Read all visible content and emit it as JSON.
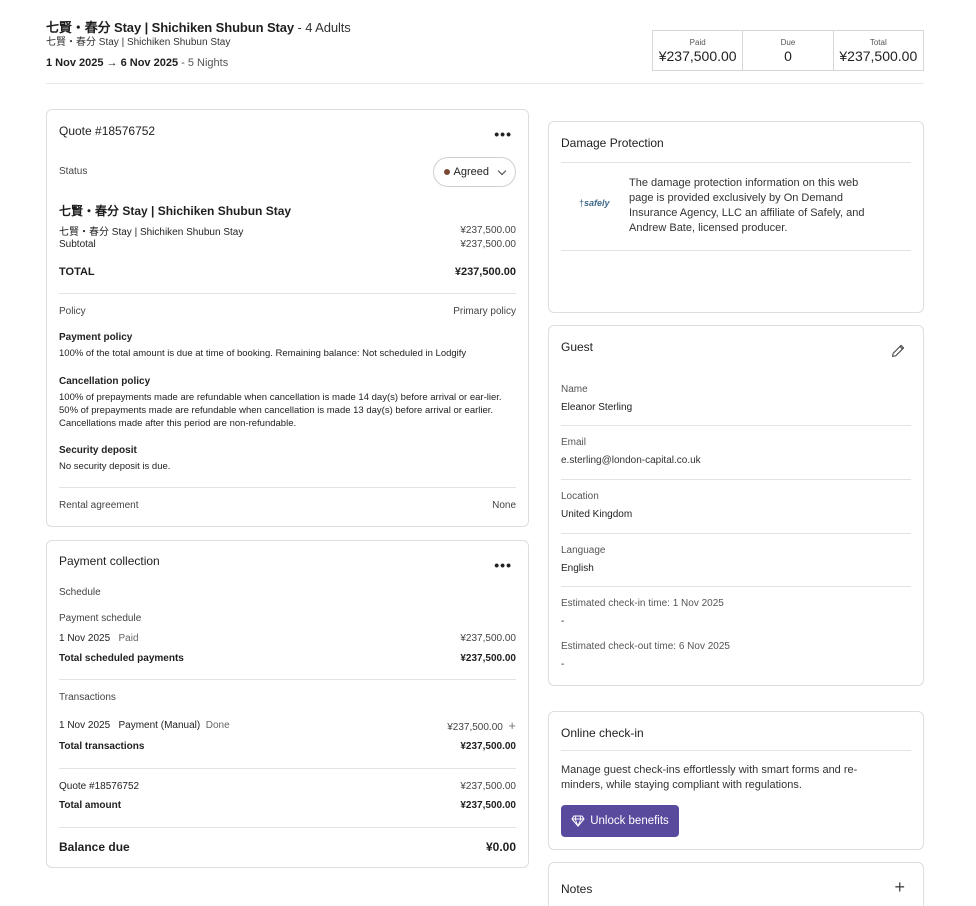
{
  "header": {
    "title_main": "七賢・春分 Stay | Shichiken Shubun Stay",
    "title_guests": " - 4 Adults",
    "subtitle": "七賢・春分 Stay | Shichiken Shubun Stay",
    "dates": "1 Nov 2025 → 6 Nov 2025",
    "nights": " - 5 Nights"
  },
  "summary": {
    "paid_label": "Paid",
    "paid_value": "¥237,500.00",
    "due_label": "Due",
    "due_value": "0",
    "total_label": "Total",
    "total_value": "¥237,500.00"
  },
  "quote": {
    "title": "Quote #18576752",
    "status_label": "Status",
    "status_value": "Agreed",
    "listing_title": "七賢・春分 Stay | Shichiken Shubun Stay",
    "line_item_label": "七賢・春分 Stay | Shichiken Shubun Stay",
    "line_item_value": "¥237,500.00",
    "subtotal_label": "Subtotal",
    "subtotal_value": "¥237,500.00",
    "total_label": "TOTAL",
    "total_value": "¥237,500.00",
    "policy_label": "Policy",
    "policy_value": "Primary policy",
    "payment_policy_heading": "Payment policy",
    "payment_policy_text": "100% of the total amount is due at time of booking. Remaining balance: Not scheduled in Lodgify",
    "cancellation_heading": "Cancellation policy",
    "cancellation_text": "100% of prepayments made are refundable when cancellation is made 14 day(s) before arrival or ear-lier. 50% of prepayments made are refundable when cancellation is made 13 day(s) before arrival or earlier. Cancellations made after this period are non-refundable.",
    "security_heading": "Security deposit",
    "security_text": "No security deposit is due.",
    "rental_label": "Rental agreement",
    "rental_value": "None"
  },
  "payment_collection": {
    "title": "Payment collection",
    "schedule_label": "Schedule",
    "payment_schedule_label": "Payment schedule",
    "schedule_date": "1 Nov 2025",
    "schedule_status": "Paid",
    "schedule_amount": "¥237,500.00",
    "total_scheduled_label": "Total scheduled payments",
    "total_scheduled_value": "¥237,500.00",
    "transactions_label": "Transactions",
    "tx_date": "1 Nov 2025",
    "tx_type": "Payment (Manual)",
    "tx_status": "Done",
    "tx_amount": "¥237,500.00",
    "total_tx_label": "Total transactions",
    "total_tx_value": "¥237,500.00",
    "quote_ref_label": "Quote #18576752",
    "quote_ref_value": "¥237,500.00",
    "total_amount_label": "Total amount",
    "total_amount_value": "¥237,500.00",
    "balance_label": "Balance due",
    "balance_value": "¥0.00"
  },
  "damage": {
    "title": "Damage Protection",
    "logo_text": "safely",
    "text": "The damage protection information on this web page is provided exclusively by On Demand Insurance Agency, LLC an affiliate of Safely, and Andrew Bate, licensed producer."
  },
  "guest": {
    "title": "Guest",
    "name_label": "Name",
    "name_value": "Eleanor Sterling",
    "email_label": "Email",
    "email_value": "e.sterling@london-capital.co.uk",
    "location_label": "Location",
    "location_value": "United Kingdom",
    "language_label": "Language",
    "language_value": "English",
    "checkin_label": "Estimated check-in time: 1 Nov 2025",
    "checkin_value": "-",
    "checkout_label": "Estimated check-out time: 6 Nov 2025",
    "checkout_value": "-"
  },
  "online_checkin": {
    "title": "Online check-in",
    "text": "Manage guest check-ins effortlessly with smart forms and re-minders, while staying compliant with regulations.",
    "button_label": "Unlock benefits"
  },
  "notes": {
    "title": "Notes"
  },
  "colors": {
    "accent_button": "#5a4a9e",
    "agreed_dot": "#7a4a32",
    "border": "#dedede"
  },
  "icons": [
    "more-dots-icon",
    "chevron-down-icon",
    "edit-pencil-icon",
    "plus-icon",
    "diamond-icon",
    "safely-logo"
  ]
}
